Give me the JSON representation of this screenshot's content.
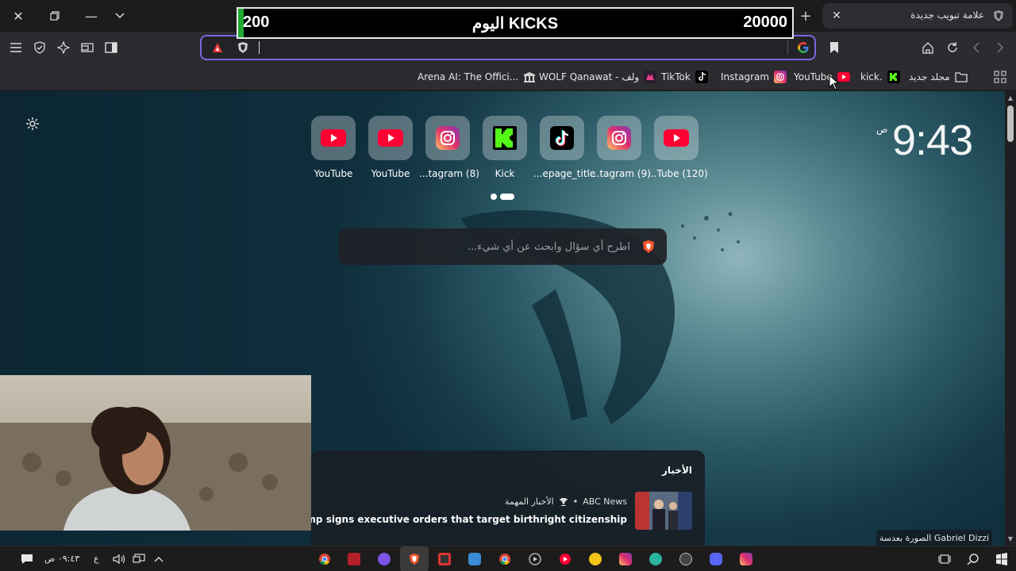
{
  "goal_overlay": {
    "current": "200",
    "label": "اليوم KICKS",
    "target": "20000",
    "progress_fraction": 0.01
  },
  "tab": {
    "title": "علامة تبويب جديدة"
  },
  "address_bar": {
    "value": ""
  },
  "bookmarks": [
    {
      "label": "Arena AI: The Offici...",
      "icon": "arena-icon"
    },
    {
      "label": "WOLF Qanawat - ولف",
      "icon": "wolf-icon"
    },
    {
      "label": "TikTok",
      "icon": "tiktok-icon"
    },
    {
      "label": "Instagram",
      "icon": "instagram-icon"
    },
    {
      "label": "YouTube",
      "icon": "youtube-icon"
    },
    {
      "label": "kick.",
      "icon": "kick-icon"
    },
    {
      "label": "مجلد جديد",
      "icon": "folder-icon"
    }
  ],
  "top_sites": [
    {
      "label": "YouTube",
      "icon": "youtube-icon"
    },
    {
      "label": "YouTube",
      "icon": "youtube-icon"
    },
    {
      "label": "...tagram (8)",
      "icon": "instagram-icon"
    },
    {
      "label": "Kick",
      "icon": "kick-icon"
    },
    {
      "label": "...epage_title",
      "icon": "tiktok-icon"
    },
    {
      "label": "...tagram (9)",
      "icon": "instagram-icon"
    },
    {
      "label": "...Tube (120)",
      "icon": "youtube-icon"
    }
  ],
  "clock": {
    "time": "9:43",
    "ampm": "ص"
  },
  "search": {
    "placeholder": "اطرح أي سؤال وابحث عن أي شيء..."
  },
  "news": {
    "heading": "الأخبار",
    "source": "ABC News",
    "category": "الأخبار المهمة",
    "headline": "Trump signs executive orders that target birthright citizenship"
  },
  "photo_credit": "الصورة بعدسة Gabriel Dizzi",
  "taskbar": {
    "time": "٠٩:٤٣ ص",
    "language": "ع"
  },
  "colors": {
    "accent": "#7a67e0",
    "youtube": "#ff0033",
    "kick": "#53fc18",
    "goal_fill": "#1faa34"
  }
}
